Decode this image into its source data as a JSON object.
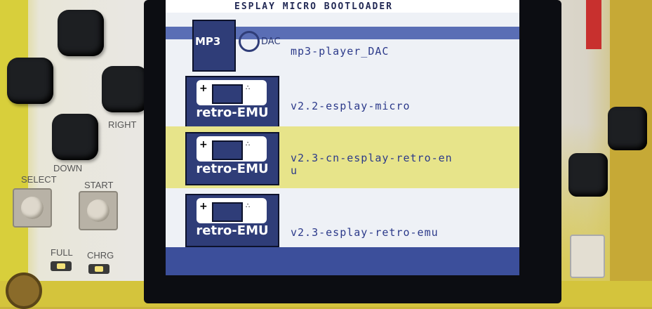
{
  "screen": {
    "title": "ESPLAY MICRO BOOTLOADER",
    "items": [
      {
        "icon": "mp3-dac-icon",
        "icon_label": "MP3",
        "icon_sublabel": "DAC",
        "text": "mp3-player_DAC",
        "selected": false
      },
      {
        "icon": "handheld-console-icon",
        "icon_label": "retro-EMU",
        "text": "v2.2-esplay-micro",
        "selected": false
      },
      {
        "icon": "handheld-console-icon",
        "icon_label": "retro-EMU",
        "text": "v2.3-cn-esplay-retro-en\nu",
        "selected": true
      },
      {
        "icon": "handheld-console-icon",
        "icon_label": "retro-EMU",
        "text": "v2.3-esplay-retro-emu",
        "selected": false
      }
    ]
  },
  "device": {
    "labels": {
      "right": "RIGHT",
      "down": "DOWN",
      "select": "SELECT",
      "start": "START",
      "full": "FULL",
      "chrg": "CHRG"
    },
    "colors": {
      "screen_accent": "#2f3d78",
      "selected_row": "#e7e48a",
      "pcb_yellow": "#d4c43c"
    }
  }
}
